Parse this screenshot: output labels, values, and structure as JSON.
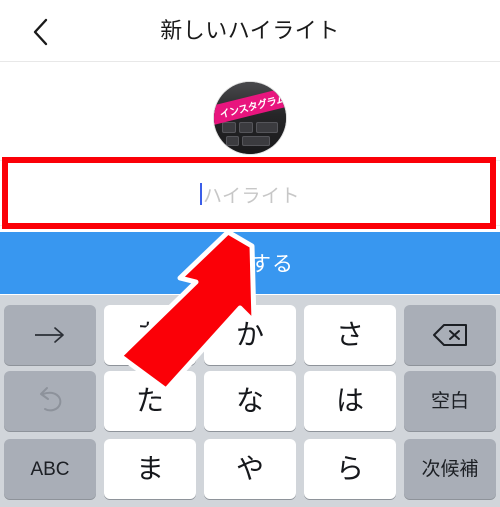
{
  "header": {
    "title": "新しいハイライト",
    "back_icon": "chevron-left-icon"
  },
  "avatar": {
    "name": "highlight-cover-avatar",
    "band_text": "インスタグラム"
  },
  "name_input": {
    "value": "",
    "placeholder": "ハイライト",
    "caret_color": "#3b5ee8",
    "placeholder_color": "#c7c7c7"
  },
  "annotation": {
    "box_color": "#fb0007",
    "arrow_color": "#fb0007",
    "arrow_outline": "#ffffff"
  },
  "add_button": {
    "label": "追加する",
    "background": "#3897f0",
    "text_color": "#ffffff"
  },
  "keyboard": {
    "background": "#d1d5da",
    "key_background": "#ffffff",
    "function_key_background": "#a9aeb7",
    "rows": [
      [
        {
          "label": "→",
          "type": "function",
          "icon": "arrow-right-icon",
          "name": "key-next-candidate"
        },
        {
          "label": "あ",
          "type": "char",
          "icon": "",
          "name": "key-a"
        },
        {
          "label": "か",
          "type": "char",
          "icon": "",
          "name": "key-ka"
        },
        {
          "label": "さ",
          "type": "char",
          "icon": "",
          "name": "key-sa"
        },
        {
          "label": "",
          "type": "function",
          "icon": "backspace-icon",
          "name": "key-delete"
        }
      ],
      [
        {
          "label": "↺",
          "type": "function",
          "icon": "undo-icon",
          "name": "key-undo"
        },
        {
          "label": "た",
          "type": "char",
          "icon": "",
          "name": "key-ta"
        },
        {
          "label": "な",
          "type": "char",
          "icon": "",
          "name": "key-na"
        },
        {
          "label": "は",
          "type": "char",
          "icon": "",
          "name": "key-ha"
        },
        {
          "label": "空白",
          "type": "function",
          "icon": "",
          "name": "key-space"
        }
      ],
      [
        {
          "label": "ABC",
          "type": "function",
          "icon": "",
          "name": "key-abc"
        },
        {
          "label": "ま",
          "type": "char",
          "icon": "",
          "name": "key-ma"
        },
        {
          "label": "や",
          "type": "char",
          "icon": "",
          "name": "key-ya"
        },
        {
          "label": "ら",
          "type": "char",
          "icon": "",
          "name": "key-ra"
        },
        {
          "label": "次候補",
          "type": "function",
          "icon": "",
          "name": "key-next"
        }
      ]
    ]
  }
}
